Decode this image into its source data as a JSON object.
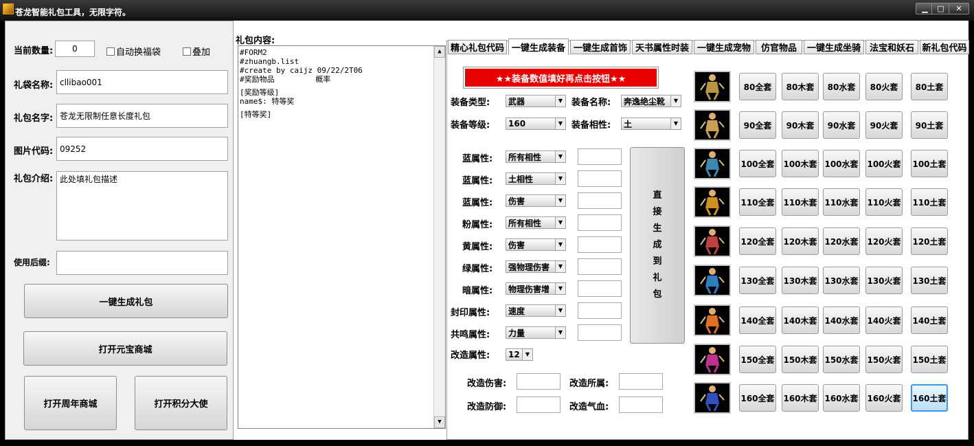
{
  "window": {
    "title": "苍龙智能礼包工具，无限字符。",
    "min_label": "▁",
    "max_label": "□",
    "close_label": "✕"
  },
  "left": {
    "count_label": "当前数量:",
    "count_value": "0",
    "auto_bag_label": "自动换福袋",
    "stack_label": "叠加",
    "bag_name_label": "礼袋名称:",
    "bag_name_value": "cllibao001",
    "pack_name_label": "礼包名字:",
    "pack_name_value": "苍龙无限制任意长度礼包",
    "image_code_label": "图片代码:",
    "image_code_value": "09252",
    "intro_label": "礼包介绍:",
    "intro_value": "此处填礼包描述",
    "suffix_label": "使用后缀:",
    "suffix_value": "",
    "generate_btn": "一键生成礼包",
    "open_yuanbao_btn": "打开元宝商城",
    "open_anniv_btn": "打开周年商城",
    "open_points_btn": "打开积分大使"
  },
  "content": {
    "label": "礼包内容:",
    "lines": [
      "#FORM2",
      "#zhuangb.list",
      "#create by caijz 09/22/2T06",
      "#奖励物品         概率",
      "",
      "[奖励等级]",
      "name$: 特等奖",
      "",
      "[特等奖]"
    ]
  },
  "tabs": [
    "精心礼包代码",
    "一键生成装备",
    "一键生成首饰",
    "天书属性时装",
    "一键生成宠物",
    "仿官物品",
    "一键生成坐骑",
    "法宝和妖石",
    "新礼包代码"
  ],
  "equip": {
    "red_button": "★★装备数值填好再点击按钮★★",
    "type_label": "装备类型:",
    "type_value": "武器",
    "name_label": "装备名称:",
    "name_value": "奔逸绝尘靴",
    "level_label": "装备等级:",
    "level_value": "160",
    "phase_label": "装备相性:",
    "phase_value": "土",
    "attrs": [
      {
        "label": "蓝属性:",
        "value": "所有相性"
      },
      {
        "label": "蓝属性:",
        "value": "土相性"
      },
      {
        "label": "蓝属性:",
        "value": "伤害"
      },
      {
        "label": "粉属性:",
        "value": "所有相性"
      },
      {
        "label": "黄属性:",
        "value": "伤害"
      },
      {
        "label": "绿属性:",
        "value": "强物理伤害"
      },
      {
        "label": "暗属性:",
        "value": "物理伤害增"
      },
      {
        "label": "封印属性:",
        "value": "速度"
      },
      {
        "label": "共鸣属性:",
        "value": "力量"
      }
    ],
    "reform_label": "改造属性:",
    "reform_value": "12",
    "generate_chars": [
      "直",
      "接",
      "生",
      "成",
      "到",
      "礼",
      "包"
    ],
    "reform_damage": "改造伤害:",
    "reform_phase": "改造所属:",
    "reform_defense": "改造防御:",
    "reform_hp": "改造气血:"
  },
  "sets": {
    "levels": [
      "80",
      "90",
      "100",
      "110",
      "120",
      "130",
      "140",
      "150",
      "160"
    ],
    "kinds": [
      "全套",
      "木套",
      "水套",
      "火套",
      "土套"
    ]
  },
  "colors": {
    "accent_red": "#e80000",
    "highlight": "#3c9ae8"
  }
}
